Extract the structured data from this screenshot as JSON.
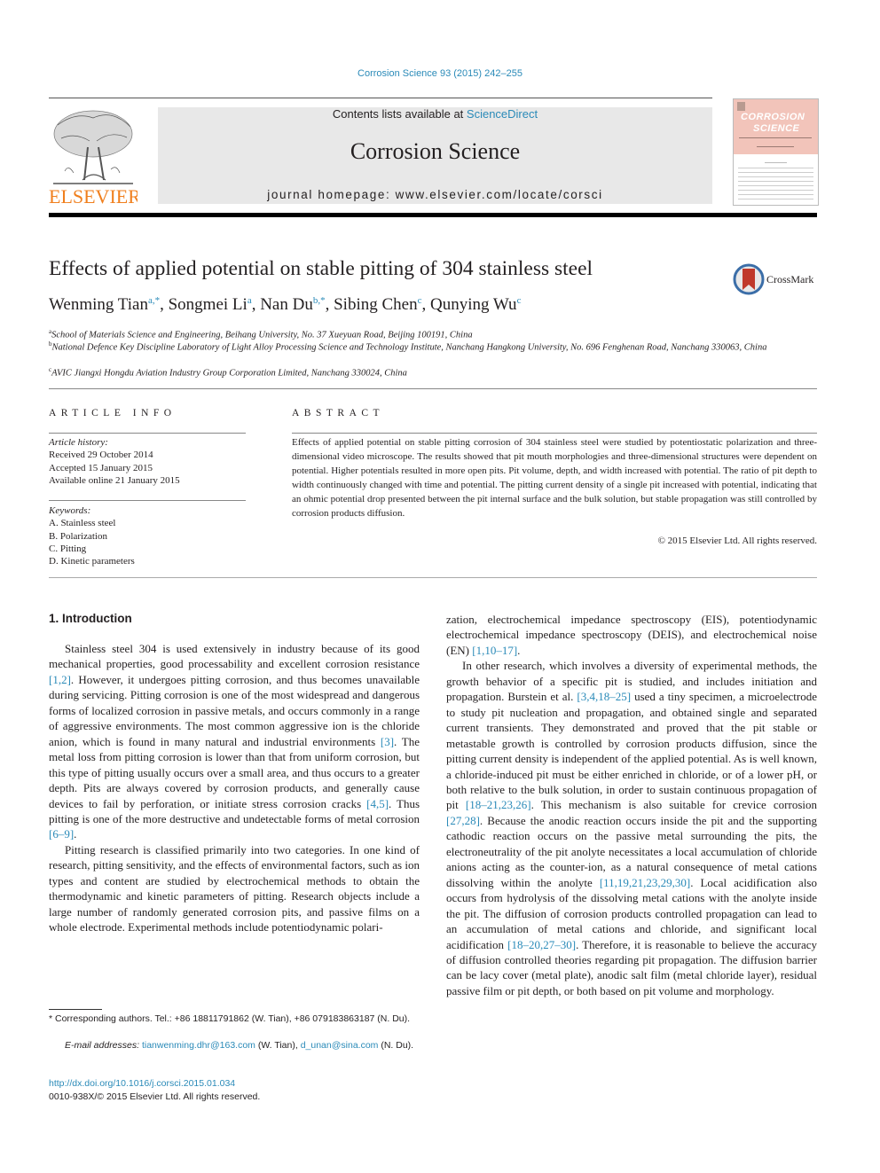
{
  "citation": "Corrosion Science 93 (2015) 242–255",
  "header": {
    "contents_prefix": "Contents lists available at ",
    "contents_link": "ScienceDirect",
    "journal_title": "Corrosion Science",
    "homepage": "journal homepage: www.elsevier.com/locate/corsci",
    "publisher_logo_text": "ELSEVIER",
    "cover_title_line1": "CORROSION",
    "cover_title_line2": "SCIENCE"
  },
  "colors": {
    "link": "#2a8ab8",
    "elsevier_orange": "#f07f1d",
    "cover_pink": "#f2c4ba",
    "crossmark_red": "#c0392b",
    "banner_gray": "#e8e8e8"
  },
  "article": {
    "title": "Effects of applied potential on stable pitting of 304 stainless steel",
    "crossmark_label": "CrossMark",
    "authors": [
      {
        "name": "Wenming Tian",
        "sup": "a,*",
        "sep": ", "
      },
      {
        "name": "Songmei Li",
        "sup": "a",
        "sep": ", "
      },
      {
        "name": "Nan Du",
        "sup": "b,*",
        "sep": ", "
      },
      {
        "name": "Sibing Chen",
        "sup": "c",
        "sep": ", "
      },
      {
        "name": "Qunying Wu",
        "sup": "c",
        "sep": ""
      }
    ],
    "affiliations": [
      {
        "key": "a",
        "text": "School of Materials Science and Engineering, Beihang University, No. 37 Xueyuan Road, Beijing 100191, China"
      },
      {
        "key": "b",
        "text": "National Defence Key Discipline Laboratory of Light Alloy Processing Science and Technology Institute, Nanchang Hangkong University, No. 696 Fenghenan Road, Nanchang 330063, China"
      },
      {
        "key": "c",
        "text": "AVIC Jiangxi Hongdu Aviation Industry Group Corporation Limited, Nanchang 330024, China"
      }
    ]
  },
  "article_info": {
    "heading": "ARTICLE INFO",
    "history_label": "Article history:",
    "received": "Received 29 October 2014",
    "accepted": "Accepted 15 January 2015",
    "online": "Available online 21 January 2015",
    "keywords_label": "Keywords:",
    "keywords": [
      "A. Stainless steel",
      "B. Polarization",
      "C. Pitting",
      "D. Kinetic parameters"
    ]
  },
  "abstract": {
    "heading": "ABSTRACT",
    "text": "Effects of applied potential on stable pitting corrosion of 304 stainless steel were studied by potentiostatic polarization and three-dimensional video microscope. The results showed that pit mouth morphologies and three-dimensional structures were dependent on potential. Higher potentials resulted in more open pits. Pit volume, depth, and width increased with potential. The ratio of pit depth to width continuously changed with time and potential. The pitting current density of a single pit increased with potential, indicating that an ohmic potential drop presented between the pit internal surface and the bulk solution, but stable propagation was still controlled by corrosion products diffusion.",
    "copyright": "© 2015 Elsevier Ltd. All rights reserved."
  },
  "intro": {
    "heading": "1. Introduction",
    "p1": [
      {
        "t": "Stainless steel 304 is used extensively in industry because of its good mechanical properties, good processability and excellent corrosion resistance "
      },
      {
        "ref": "[1,2]"
      },
      {
        "t": ". However, it undergoes pitting corrosion, and thus becomes unavailable during servicing. Pitting corrosion is one of the most widespread and dangerous forms of localized corrosion in passive metals, and occurs commonly in a range of aggressive environments. The most common aggressive ion is the chloride anion, which is found in many natural and industrial environments "
      },
      {
        "ref": "[3]"
      },
      {
        "t": ". The metal loss from pitting corrosion is lower than that from uniform corrosion, but this type of pitting usually occurs over a small area, and thus occurs to a greater depth. Pits are always covered by corrosion products, and generally cause devices to fail by perforation, or initiate stress corrosion cracks "
      },
      {
        "ref": "[4,5]"
      },
      {
        "t": ". Thus pitting is one of the more destructive and undetectable forms of metal corrosion "
      },
      {
        "ref": "[6–9]"
      },
      {
        "t": "."
      }
    ],
    "p2": [
      {
        "t": "Pitting research is classified primarily into two categories. In one kind of research, pitting sensitivity, and the effects of environmental factors, such as ion types and content are studied by electrochemical methods to obtain the thermodynamic and kinetic parameters of pitting. Research objects include a large number of randomly generated corrosion pits, and passive films on a whole electrode. Experimental methods include potentiodynamic polarization, electrochemical impedance spectroscopy (EIS), potentiodynamic electrochemical impedance spectroscopy (DEIS), and electrochemical noise (EN) "
      },
      {
        "ref": "[1,10–17]"
      },
      {
        "t": "."
      }
    ],
    "p3": [
      {
        "t": "In other research, which involves a diversity of experimental methods, the growth behavior of a specific pit is studied, and includes initiation and propagation. Burstein et al. "
      },
      {
        "ref": "[3,4,18–25]"
      },
      {
        "t": " used a tiny specimen, a microelectrode to study pit nucleation and propagation, and obtained single and separated current transients. They demonstrated and proved that the pit stable or metastable growth is controlled by corrosion products diffusion, since the pitting current density is independent of the applied potential. As is well known, a chloride-induced pit must be either enriched in chloride, or of a lower pH, or both relative to the bulk solution, in order to sustain continuous propagation of pit "
      },
      {
        "ref": "[18–21,23,26]"
      },
      {
        "t": ". This mechanism is also suitable for crevice corrosion "
      },
      {
        "ref": "[27,28]"
      },
      {
        "t": ". Because the anodic reaction occurs inside the pit and the supporting cathodic reaction occurs on the passive metal surrounding the pits, the electroneutrality of the pit anolyte necessitates a local accumulation of chloride anions acting as the counter-ion, as a natural consequence of metal cations dissolving within the anolyte "
      },
      {
        "ref": "[11,19,21,23,29,30]"
      },
      {
        "t": ". Local acidification also occurs from hydrolysis of the dissolving metal cations with the anolyte inside the pit. The diffusion of corrosion products controlled propagation can lead to an accumulation of metal cations and chloride, and significant local acidification "
      },
      {
        "ref": "[18–20,27–30]"
      },
      {
        "t": ". Therefore, it is reasonable to believe the accuracy of diffusion controlled theories regarding pit propagation. The diffusion barrier can be lacy cover (metal plate), anodic salt film (metal chloride layer), residual passive film or pit depth, or both based on pit volume and morphology."
      }
    ]
  },
  "footnotes": {
    "corresponding": "* Corresponding authors. Tel.: +86 18811791862 (W. Tian), +86 079183863187 (N. Du).",
    "email_label": "E-mail addresses:",
    "email1": "tianwenming.dhr@163.com",
    "email1_who": " (W. Tian), ",
    "email2": "d_unan@sina.com",
    "email2_who": " (N. Du).",
    "doi": "http://dx.doi.org/10.1016/j.corsci.2015.01.034",
    "issn": "0010-938X/© 2015 Elsevier Ltd. All rights reserved."
  }
}
